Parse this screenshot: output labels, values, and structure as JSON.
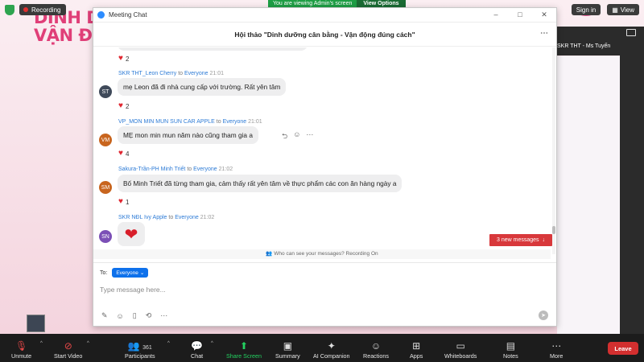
{
  "top_bar": {
    "recording_label": "Recording",
    "view_banner_text": "You are viewing Admin's screen",
    "view_options_label": "View Options",
    "sign_in_label": "Sign in",
    "view_label": "View"
  },
  "slide": {
    "line1": "DINH DU",
    "line2": "VẬN ĐỘI"
  },
  "gallery": {
    "participant_name": "SKR THT - Ms Tuyến"
  },
  "chat_window": {
    "title": "Meeting Chat",
    "header": "Hội thảo \"Dinh dưỡng cân bằng - Vận động đúng cách\"",
    "minimize": "–",
    "maximize": "□",
    "close": "✕",
    "reaction_top": {
      "emoji": "heart",
      "count": "2"
    },
    "messages": [
      {
        "initials": "ST",
        "avatar_color": "#3f4a5a",
        "sender": "SKR THT_Leon Cherry",
        "to_word": "to",
        "recipient": "Everyone",
        "time": "21:01",
        "text": "mẹ Leon đã đi nhà cung cấp với trường. Rất yên tâm",
        "reaction_count": "2"
      },
      {
        "initials": "VM",
        "avatar_color": "#c8651e",
        "sender": "VP_MON MIN MUN SUN CAR APPLE",
        "to_word": "to",
        "recipient": "Everyone",
        "time": "21:01",
        "text": "MẸ mon min mun năm nào cũng tham gia a",
        "reaction_count": "4"
      },
      {
        "initials": "SM",
        "avatar_color": "#c8651e",
        "sender": "Sakura-Trần-PH Minh Triết",
        "to_word": "to",
        "recipient": "Everyone",
        "time": "21:02",
        "text": "Bố Minh Triết đã từng tham gia, cảm thấy rất yên tâm về thực phẩm các con ăn hàng ngày a",
        "reaction_count": "1"
      },
      {
        "initials": "SN",
        "avatar_color": "#7b4fb6",
        "sender": "SKR NĐL Ivy Apple",
        "to_word": "to",
        "recipient": "Everyone",
        "time": "21:02",
        "text": "❤"
      }
    ],
    "new_messages_label": "3 new messages",
    "who_can_see": "Who can see your messages? Recording On",
    "to_label": "To:",
    "to_value": "Everyone",
    "input_placeholder": "Type message here..."
  },
  "toolbar": {
    "unmute": "Unmute",
    "start_video": "Start Video",
    "participants": "Participants",
    "participants_count": "361",
    "chat": "Chat",
    "share_screen": "Share Screen",
    "summary": "Summary",
    "ai_companion": "AI Companion",
    "reactions": "Reactions",
    "apps": "Apps",
    "whiteboards": "Whiteboards",
    "notes": "Notes",
    "more": "More",
    "leave": "Leave"
  },
  "colors": {
    "accent_blue": "#2d8cff",
    "recipient_blue": "#0e71eb",
    "new_msg_red": "#d8383b",
    "heart_red": "#e02630",
    "share_green": "#23d160",
    "leave_red": "#d32f2f"
  }
}
